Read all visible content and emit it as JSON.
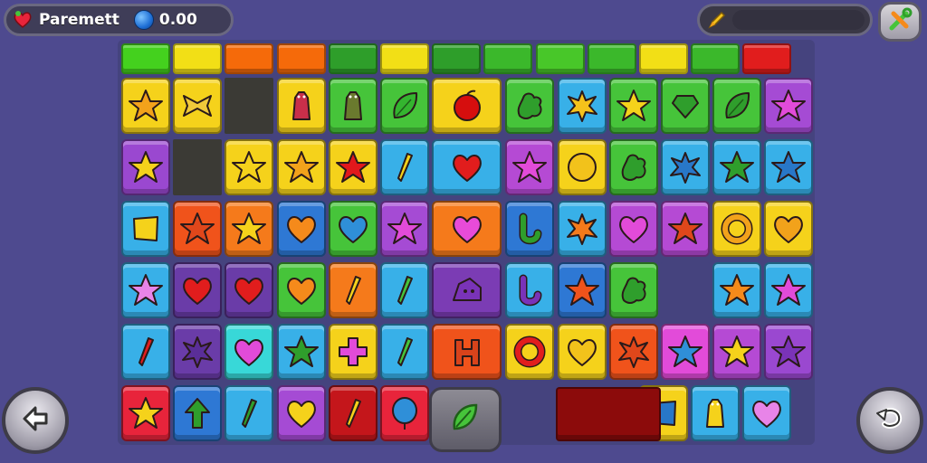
{
  "hud": {
    "title": "Paremett",
    "score": "0.00",
    "icons": {
      "lives": "heart-icon",
      "currency": "gem-icon",
      "tool": "pencil-icon",
      "settings": "wrench-screwdriver-icon"
    }
  },
  "header_colors": [
    "#44d11e",
    "#f2df16",
    "#f56a0a",
    "#f56a0a",
    "#2e9e2a",
    "#f2df16",
    "#2e9e2a",
    "#3bb82b",
    "#48c729",
    "#3bb82b",
    "#f2df16",
    "#3bb82b",
    "#e11d1d"
  ],
  "rows": [
    [
      {
        "bg": "#f5d21b",
        "shape": "star",
        "fg": "#f2a21b"
      },
      {
        "bg": "#f5d21b",
        "shape": "bow",
        "fg": "#f0c93a"
      },
      null,
      {
        "bg": "#f5d21b",
        "shape": "figure",
        "fg": "#c92f4a"
      },
      {
        "bg": "#46c43a",
        "shape": "figure",
        "fg": "#6a7a2e"
      },
      {
        "bg": "#46c43a",
        "shape": "leaf",
        "fg": "#34b52f"
      },
      {
        "bg": "#f5d21b",
        "shape": "apple",
        "fg": "#d60e0e",
        "wide": true
      },
      {
        "bg": "#46c43a",
        "shape": "blob",
        "fg": "#2f9e2c"
      },
      {
        "bg": "#38b0e8",
        "shape": "splat",
        "fg": "#f5c21b"
      },
      {
        "bg": "#46c43a",
        "shape": "star",
        "fg": "#f5d21b"
      },
      {
        "bg": "#46c43a",
        "shape": "diamond",
        "fg": "#2f9e2c"
      },
      {
        "bg": "#46c43a",
        "shape": "leaf",
        "fg": "#2f9e2c"
      },
      {
        "bg": "#a54bd4",
        "shape": "star",
        "fg": "#e24bd9"
      }
    ],
    [
      {
        "bg": "#9a48d0",
        "shape": "star",
        "fg": "#f5d21b"
      },
      null,
      {
        "bg": "#f5d21b",
        "shape": "star",
        "fg": "#f5d21b"
      },
      {
        "bg": "#f5d21b",
        "shape": "star",
        "fg": "#f2a21b"
      },
      {
        "bg": "#f5d21b",
        "shape": "star",
        "fg": "#e1181c"
      },
      {
        "bg": "#38b0e8",
        "shape": "bar",
        "fg": "#f5d21b"
      },
      {
        "bg": "#38b0e8",
        "shape": "heart",
        "fg": "#e11d1d",
        "wide": true
      },
      {
        "bg": "#b54ad4",
        "shape": "star",
        "fg": "#e24bd9"
      },
      {
        "bg": "#f5d21b",
        "shape": "circle",
        "fg": "#f2c21b"
      },
      {
        "bg": "#46c43a",
        "shape": "blob",
        "fg": "#2f9e2c"
      },
      {
        "bg": "#38b0e8",
        "shape": "splat",
        "fg": "#2877c8"
      },
      {
        "bg": "#38b0e8",
        "shape": "star",
        "fg": "#2f9e2c"
      },
      {
        "bg": "#38b0e8",
        "shape": "star",
        "fg": "#2877c8"
      }
    ],
    [
      {
        "bg": "#38b0e8",
        "shape": "square",
        "fg": "#f5d21b"
      },
      {
        "bg": "#f0531b",
        "shape": "star",
        "fg": "#e0471b"
      },
      {
        "bg": "#f57a1b",
        "shape": "star",
        "fg": "#f5d21b"
      },
      {
        "bg": "#2e78d4",
        "shape": "heart",
        "fg": "#f58a1b"
      },
      {
        "bg": "#46c43a",
        "shape": "heart",
        "fg": "#2f8fd8"
      },
      {
        "bg": "#a54bd4",
        "shape": "star",
        "fg": "#e24bd9"
      },
      {
        "bg": "#f57a1b",
        "shape": "heart",
        "fg": "#e84bd9",
        "wide": true
      },
      {
        "bg": "#2e78d4",
        "shape": "hook",
        "fg": "#2f9e2c"
      },
      {
        "bg": "#38b0e8",
        "shape": "splat",
        "fg": "#f57a1b"
      },
      {
        "bg": "#b54ad4",
        "shape": "heart",
        "fg": "#e24bd9"
      },
      {
        "bg": "#b54ad4",
        "shape": "star",
        "fg": "#e0471b"
      },
      {
        "bg": "#f5d21b",
        "shape": "ring",
        "fg": "#f2a21b"
      },
      {
        "bg": "#f5d21b",
        "shape": "heart",
        "fg": "#f2a21b"
      }
    ],
    [
      {
        "bg": "#38b0e8",
        "shape": "star",
        "fg": "#e884e8"
      },
      {
        "bg": "#6a3ca8",
        "shape": "heart",
        "fg": "#e11d1d"
      },
      {
        "bg": "#6a3ca8",
        "shape": "heart",
        "fg": "#e11d1d"
      },
      {
        "bg": "#46c43a",
        "shape": "heart",
        "fg": "#f58a1b"
      },
      {
        "bg": "#f57a1b",
        "shape": "bar",
        "fg": "#f5d21b"
      },
      {
        "bg": "#38b0e8",
        "shape": "bar",
        "fg": "#46c43a"
      },
      {
        "bg": "#7b3cb4",
        "shape": "house",
        "fg": "#7a33b8",
        "wide": true
      },
      {
        "bg": "#38b0e8",
        "shape": "hook",
        "fg": "#7a33b8"
      },
      {
        "bg": "#2e78d4",
        "shape": "star",
        "fg": "#f0531b"
      },
      {
        "bg": "#46c43a",
        "shape": "blob",
        "fg": "#2f9e2c"
      },
      null,
      {
        "bg": "#38b0e8",
        "shape": "star",
        "fg": "#f58a1b"
      },
      {
        "bg": "#38b0e8",
        "shape": "star",
        "fg": "#e24bd9"
      }
    ],
    [
      {
        "bg": "#38b0e8",
        "shape": "bar",
        "fg": "#e11d1d"
      },
      {
        "bg": "#6a3ca8",
        "shape": "splat",
        "fg": "#5a2e98"
      },
      {
        "bg": "#38d8d8",
        "shape": "heart",
        "fg": "#e24bd9"
      },
      {
        "bg": "#38b0e8",
        "shape": "star",
        "fg": "#2f9e2c"
      },
      {
        "bg": "#f5d21b",
        "shape": "cross",
        "fg": "#e24bd9"
      },
      {
        "bg": "#38b0e8",
        "shape": "bar",
        "fg": "#46c43a"
      },
      {
        "bg": "#f0531b",
        "shape": "blockH",
        "fg": "#d8431b",
        "wide": true
      },
      {
        "bg": "#f5d21b",
        "shape": "ring",
        "fg": "#e11d1d"
      },
      {
        "bg": "#f5d21b",
        "shape": "heart",
        "fg": "#f2c21b"
      },
      {
        "bg": "#f0531b",
        "shape": "splat",
        "fg": "#e0471b"
      },
      {
        "bg": "#e24bd9",
        "shape": "star",
        "fg": "#2f8fd8"
      },
      {
        "bg": "#b54ad4",
        "shape": "star",
        "fg": "#f5d21b"
      },
      {
        "bg": "#9a48d0",
        "shape": "star",
        "fg": "#7a33b8"
      }
    ],
    [
      {
        "bg": "#e8243b",
        "shape": "star",
        "fg": "#f5d21b"
      },
      {
        "bg": "#2e78d4",
        "shape": "arrow",
        "fg": "#2f9e2c"
      },
      {
        "bg": "#38b0e8",
        "shape": "bar",
        "fg": "#2f9e2c"
      },
      {
        "bg": "#a54bd4",
        "shape": "heart",
        "fg": "#f5d21b"
      },
      {
        "bg": "#c4161b",
        "shape": "bar",
        "fg": "#f5d21b"
      },
      {
        "bg": "#e8243b",
        "shape": "balloon",
        "fg": "#2f8fd8"
      },
      null,
      null,
      null,
      null,
      {
        "bg": "#f5d21b",
        "shape": "square",
        "fg": "#2877c8"
      },
      {
        "bg": "#38b0e8",
        "shape": "figure",
        "fg": "#f5d21b"
      },
      {
        "bg": "#38b0e8",
        "shape": "heart",
        "fg": "#e884e8"
      }
    ]
  ],
  "nav": {
    "back": "back-arrow-icon",
    "hint": "leaf-icon",
    "undo": "undo-icon"
  }
}
